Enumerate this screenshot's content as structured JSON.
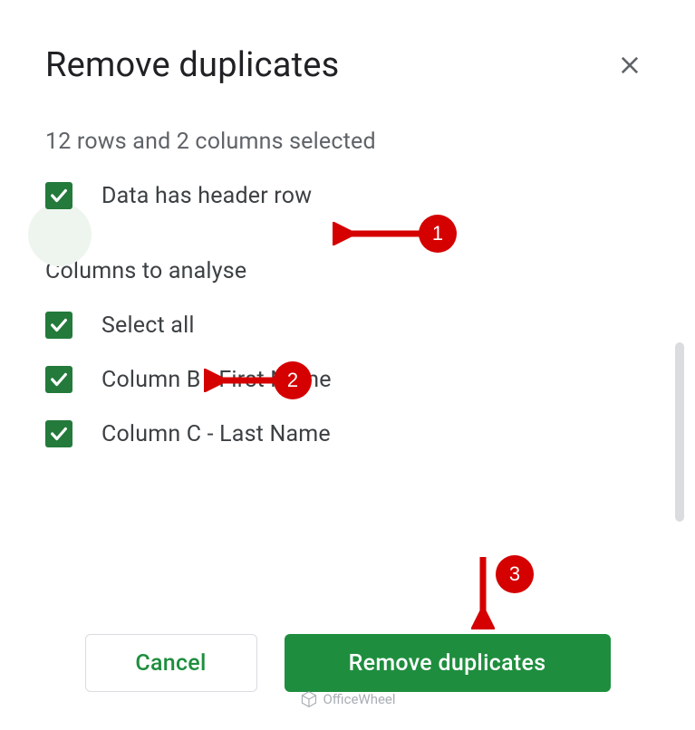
{
  "dialog": {
    "title": "Remove duplicates",
    "selection_info": "12 rows and 2 columns selected",
    "header_row_label": "Data has header row",
    "columns_section_title": "Columns to analyse",
    "select_all_label": "Select all",
    "columns": [
      {
        "label": "Column B - First Name"
      },
      {
        "label": "Column C - Last Name"
      }
    ],
    "cancel_label": "Cancel",
    "submit_label": "Remove duplicates"
  },
  "annotations": {
    "badge1": "1",
    "badge2": "2",
    "badge3": "3"
  },
  "watermark": {
    "text": "OfficeWheel"
  }
}
